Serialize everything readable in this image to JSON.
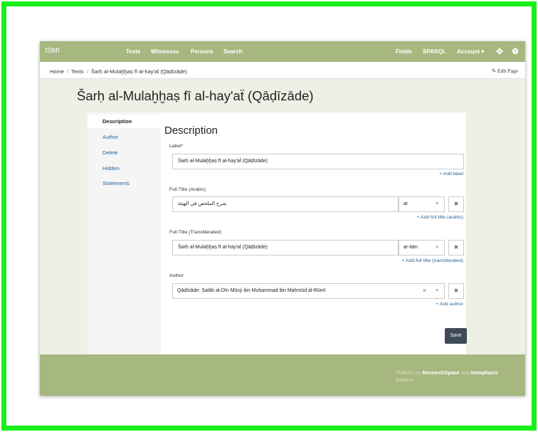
{
  "navbar": {
    "brand": "ISMI",
    "left_items": [
      "Texts",
      "Witnesses",
      "Persons",
      "Search"
    ],
    "right_items": [
      "Fields",
      "SPARQL",
      "Account"
    ],
    "account_caret": "▾"
  },
  "breadcrumb": {
    "items": [
      "Home",
      "Texts",
      "Šarḥ al-Mulaḫḫaṣ fī al-hay'aẗ (Qāḍīzāde)"
    ],
    "separator": "/",
    "edit_label": "Edit Page"
  },
  "page_title": "Šarḥ al-Mulaḫḫaṣ fī al-hay'aẗ (Qāḍīzāde)",
  "sidebar": {
    "items": [
      "Description",
      "Author",
      "Delete",
      "Hidden",
      "Statements"
    ]
  },
  "form": {
    "title": "Description",
    "label_field": {
      "label": "Label*",
      "value": "Šarḥ al-Mulaḫḫaṣ fī al-hay'aẗ (Qāḍīzāde)",
      "add_link": "+ Add label"
    },
    "title_arabic": {
      "label": "Full Title (Arabic)",
      "value": "شرح الملخص في الهيئة",
      "lang": "ar",
      "add_link": "+ Add full title (arabic)"
    },
    "title_translit": {
      "label": "Full Title (Transliterated)",
      "value": "Šarḥ al-Mulaḫḫaṣ fī al-hay'aẗ (Qāḍīzāde)",
      "lang": "ar-latn",
      "add_link": "+ Add full title (transliterated)"
    },
    "author": {
      "label": "Author",
      "value": "Qāḍīzāde: Ṣalāḥ al-Dīn Mūsý ibn Muḥammad ibn Maḥmūd al-Rūmī",
      "add_link": "+ Add author"
    },
    "save_label": "Save"
  },
  "footer": {
    "prefix": "Platform by",
    "brand1": "ResearchSpace",
    "and": "and",
    "brand2": "metaphacts",
    "suffix": "platform"
  },
  "colors": {
    "navbar": "#a6b77f",
    "frame": "#19f019",
    "link": "#2a6496",
    "save": "#3f4a58"
  }
}
